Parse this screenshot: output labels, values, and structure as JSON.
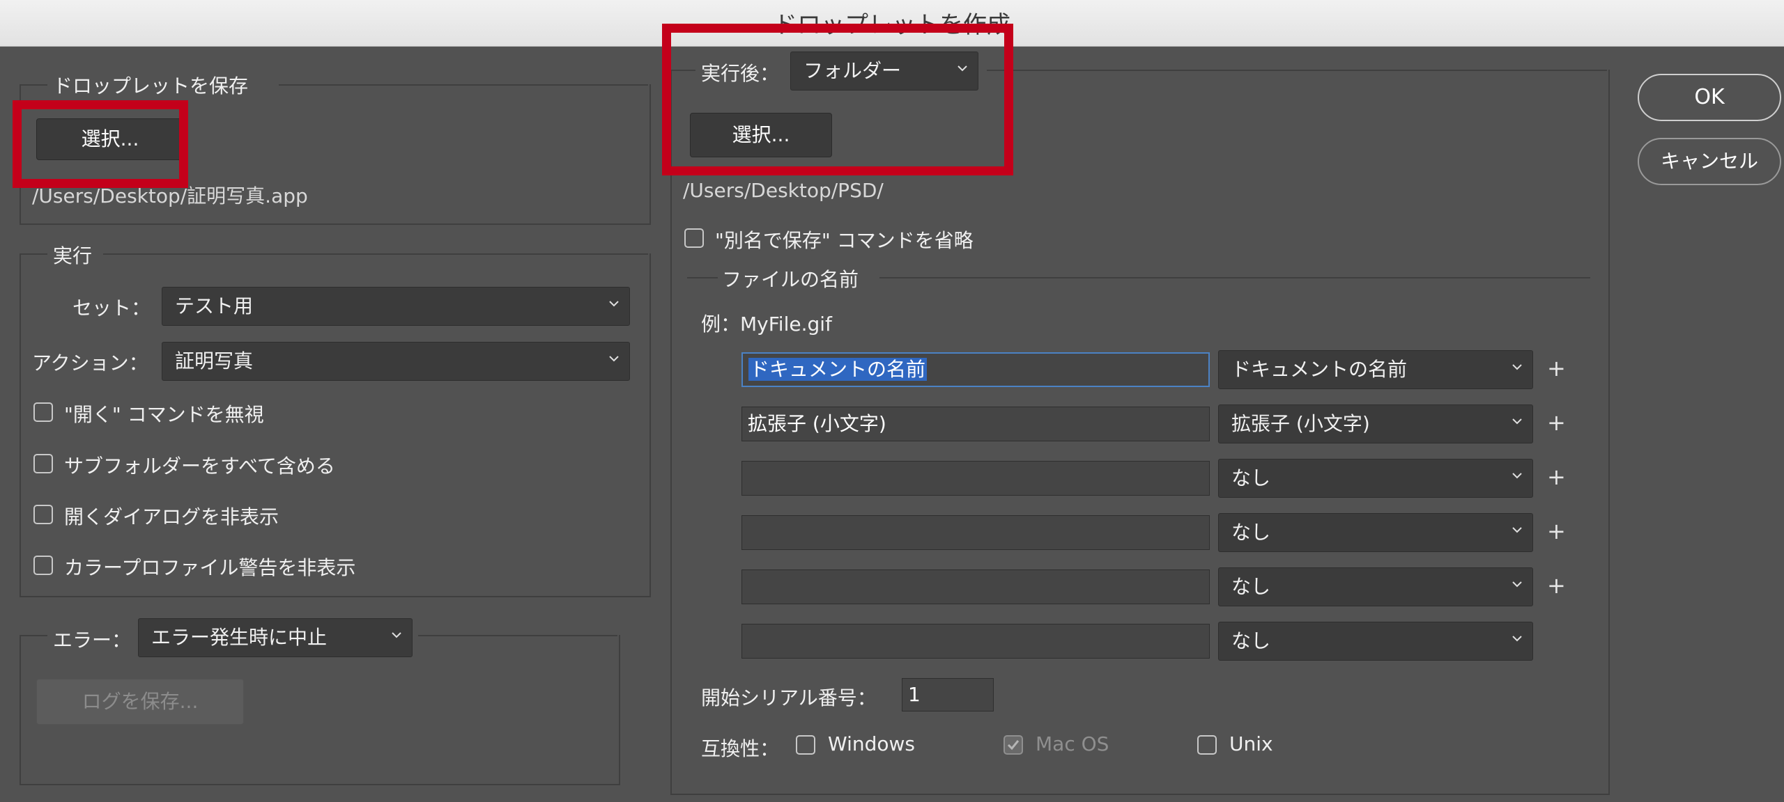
{
  "window": {
    "title": "ドロップレットを作成"
  },
  "save_droplet": {
    "legend": "ドロップレットを保存",
    "choose_label": "選択...",
    "path": "/Users/Desktop/証明写真.app"
  },
  "play": {
    "legend": "実行",
    "set_label": "セット：",
    "set_value": "テスト用",
    "action_label": "アクション：",
    "action_value": "証明写真",
    "options": [
      {
        "label": "\"開く\" コマンドを無視",
        "checked": false
      },
      {
        "label": "サブフォルダーをすべて含める",
        "checked": false
      },
      {
        "label": "開くダイアログを非表示",
        "checked": false
      },
      {
        "label": "カラープロファイル警告を非表示",
        "checked": false
      }
    ]
  },
  "errors": {
    "label": "エラー：",
    "value": "エラー発生時に中止",
    "save_log_label": "ログを保存..."
  },
  "destination": {
    "label": "実行後：",
    "value": "フォルダー",
    "choose_label": "選択...",
    "path": "/Users/Desktop/PSD/",
    "override_label": "\"別名で保存\" コマンドを省略",
    "override_checked": false
  },
  "file_naming": {
    "legend": "ファイルの名前",
    "example": "例：MyFile.gif",
    "rows": [
      {
        "text": "ドキュメントの名前",
        "select": "ドキュメントの名前",
        "plus": "+"
      },
      {
        "text": "拡張子 (小文字)",
        "select": "拡張子 (小文字)",
        "plus": "+"
      },
      {
        "text": "",
        "select": "なし",
        "plus": "+"
      },
      {
        "text": "",
        "select": "なし",
        "plus": "+"
      },
      {
        "text": "",
        "select": "なし",
        "plus": "+"
      },
      {
        "text": "",
        "select": "なし",
        "plus": ""
      }
    ],
    "serial_label": "開始シリアル番号：",
    "serial_value": "1",
    "compat_label": "互換性：",
    "compat": [
      {
        "label": "Windows",
        "checked": false,
        "enabled": true
      },
      {
        "label": "Mac OS",
        "checked": true,
        "enabled": false
      },
      {
        "label": "Unix",
        "checked": false,
        "enabled": true
      }
    ]
  },
  "buttons": {
    "ok": "OK",
    "cancel": "キャンセル"
  },
  "colors": {
    "highlight_box": "#c4001a",
    "dialog_bg": "#525252",
    "focus": "#4b82c4"
  }
}
